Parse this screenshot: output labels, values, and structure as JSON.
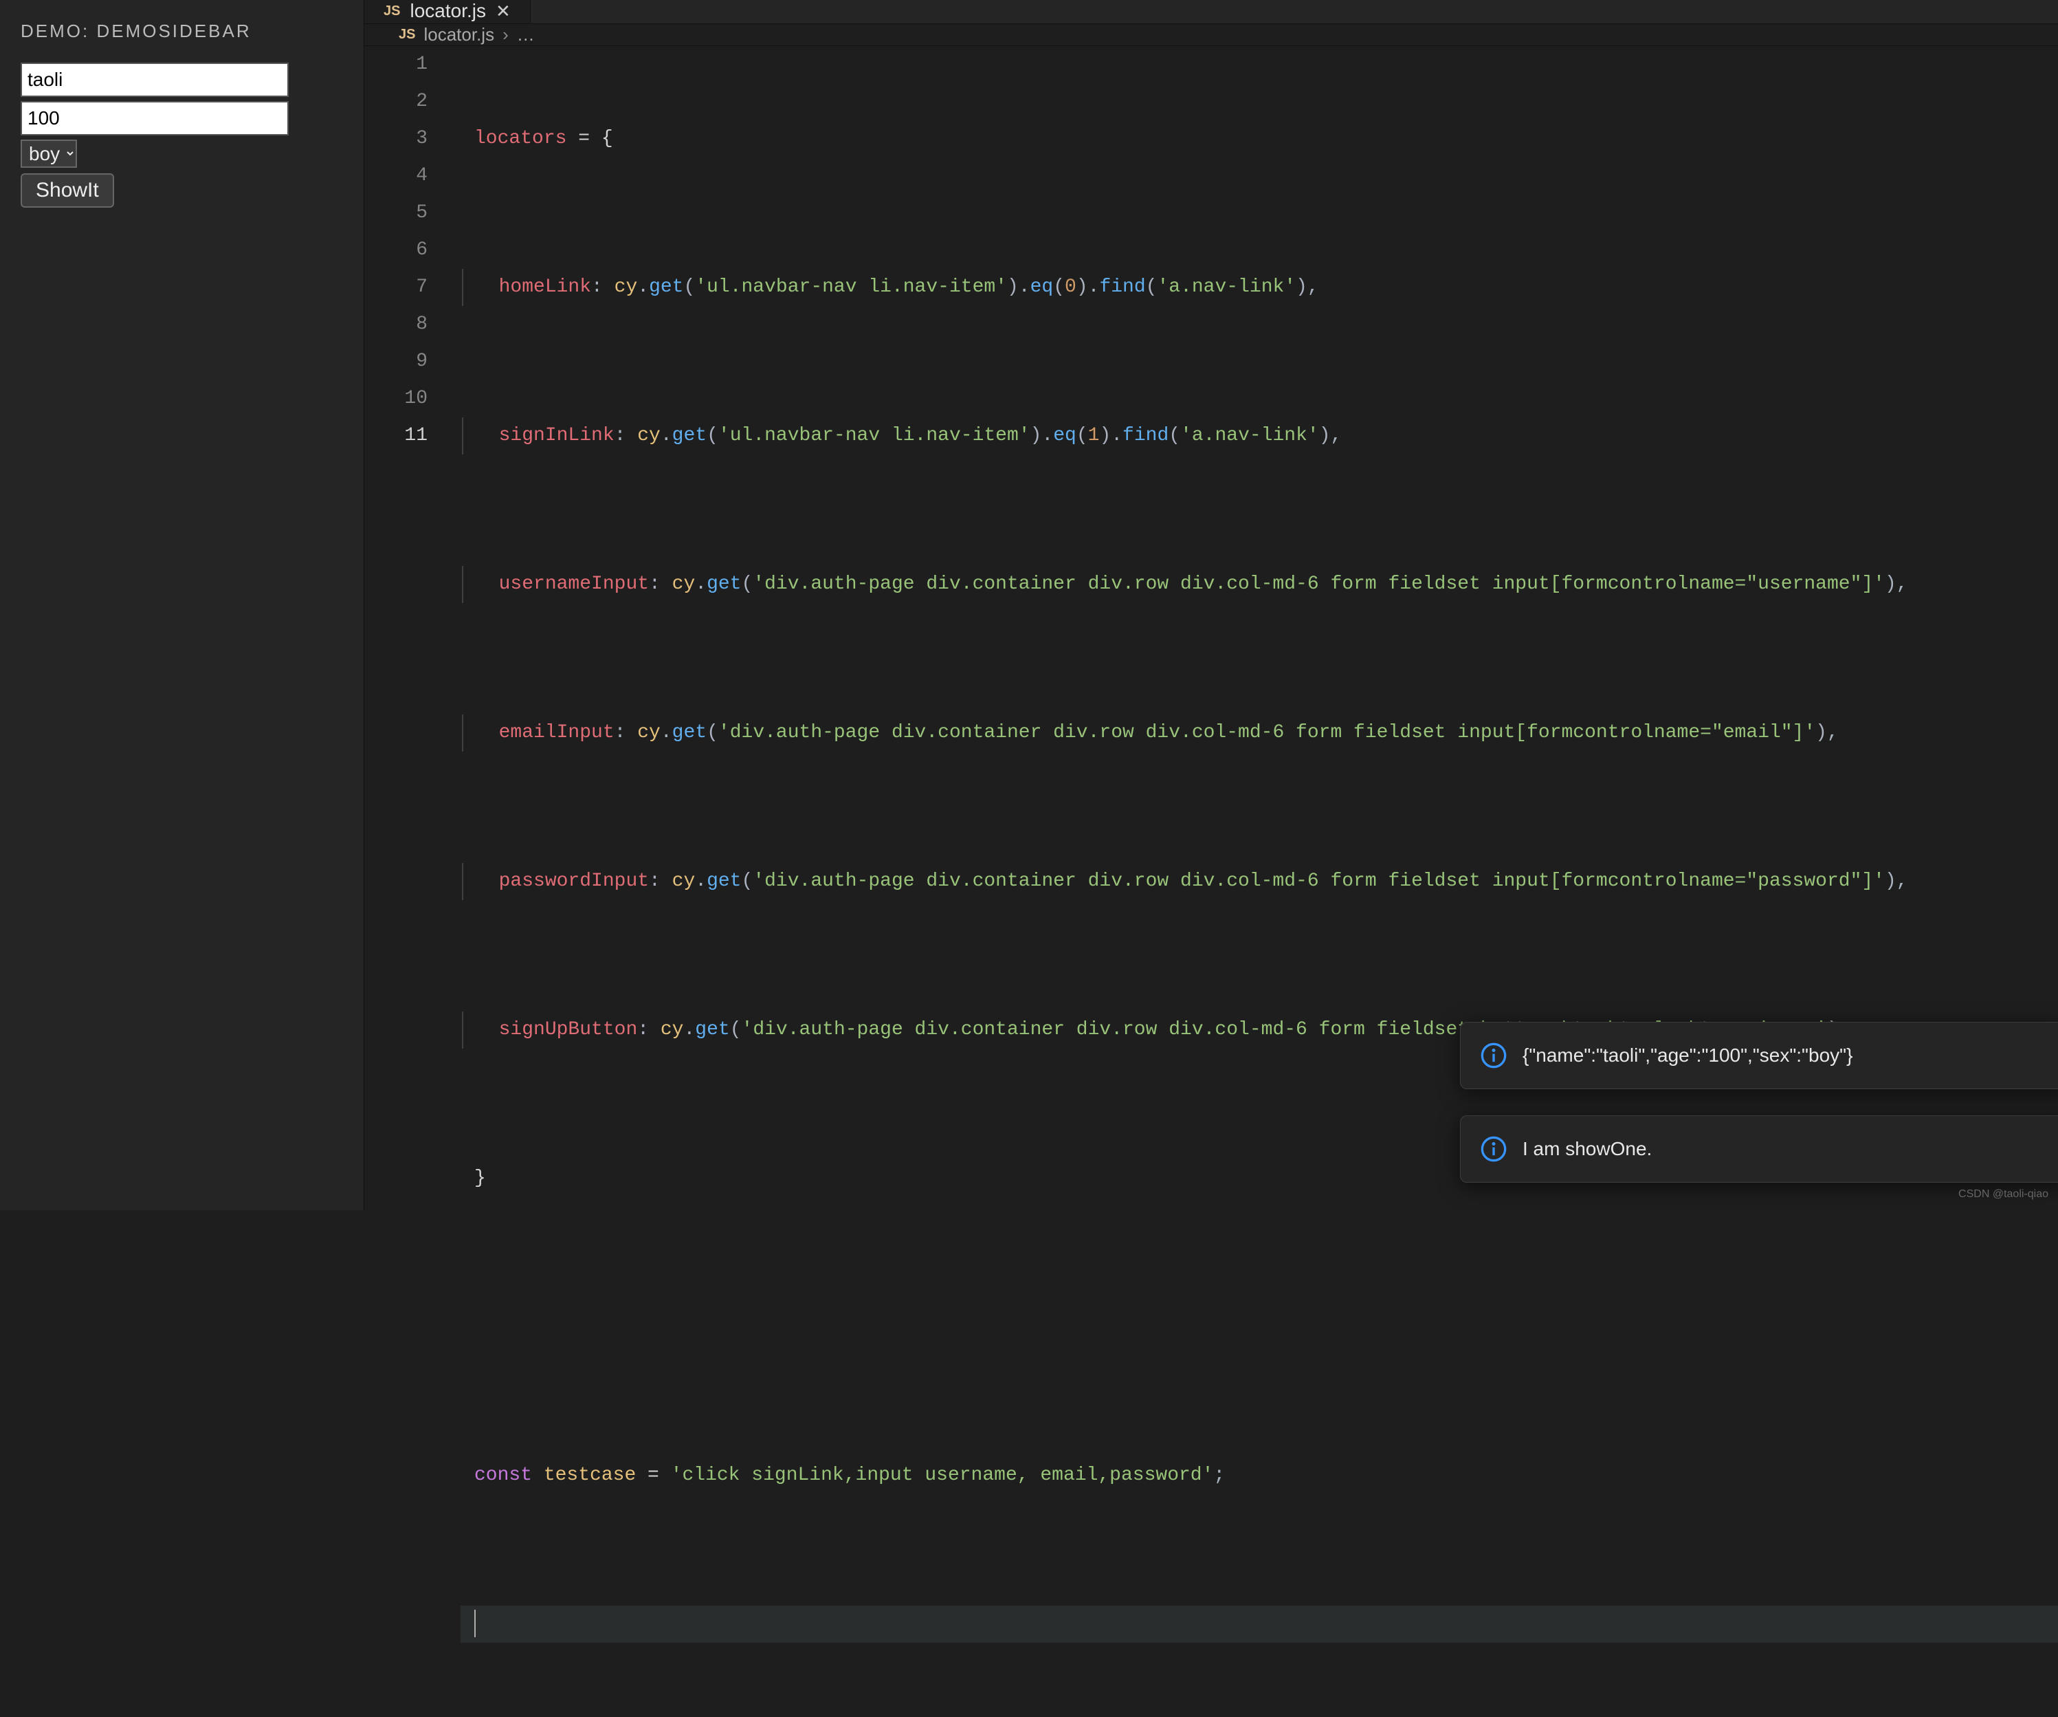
{
  "sidebar": {
    "title": "DEMO: DEMOSIDEBAR",
    "name_value": "taoli",
    "age_value": "100",
    "sex_value": "boy",
    "button_label": "ShowIt"
  },
  "tab": {
    "icon_label": "JS",
    "filename": "locator.js"
  },
  "breadcrumb": {
    "icon_label": "JS",
    "filename": "locator.js",
    "chevron": "›",
    "ellipsis": "…"
  },
  "line_numbers": [
    "1",
    "2",
    "3",
    "4",
    "5",
    "6",
    "7",
    "8",
    "9",
    "10",
    "11"
  ],
  "code": {
    "l1": {
      "a": "locators",
      "b": " = {"
    },
    "l2": {
      "prop": "homeLink",
      "colon": ": ",
      "obj": "cy",
      "dot": ".",
      "fn1": "get",
      "p1": "(",
      "s1": "'ul.navbar-nav li.nav-item'",
      "p2": ").",
      "fn2": "eq",
      "p3": "(",
      "n": "0",
      "p4": ").",
      "fn3": "find",
      "p5": "(",
      "s2": "'a.nav-link'",
      "p6": "),"
    },
    "l3": {
      "prop": "signInLink",
      "colon": ": ",
      "obj": "cy",
      "dot": ".",
      "fn1": "get",
      "p1": "(",
      "s1": "'ul.navbar-nav li.nav-item'",
      "p2": ").",
      "fn2": "eq",
      "p3": "(",
      "n": "1",
      "p4": ").",
      "fn3": "find",
      "p5": "(",
      "s2": "'a.nav-link'",
      "p6": "),"
    },
    "l4": {
      "prop": "usernameInput",
      "colon": ": ",
      "obj": "cy",
      "dot": ".",
      "fn1": "get",
      "p1": "(",
      "s1": "'div.auth-page div.container div.row div.col-md-6 form fieldset input[formcontrolname=\"username\"]'",
      "p2": "),"
    },
    "l5": {
      "prop": "emailInput",
      "colon": ": ",
      "obj": "cy",
      "dot": ".",
      "fn1": "get",
      "p1": "(",
      "s1": "'div.auth-page div.container div.row div.col-md-6 form fieldset input[formcontrolname=\"email\"]'",
      "p2": "),"
    },
    "l6": {
      "prop": "passwordInput",
      "colon": ": ",
      "obj": "cy",
      "dot": ".",
      "fn1": "get",
      "p1": "(",
      "s1": "'div.auth-page div.container div.row div.col-md-6 form fieldset input[formcontrolname=\"password\"]'",
      "p2": "),"
    },
    "l7": {
      "prop": "signUpButton",
      "colon": ": ",
      "obj": "cy",
      "dot": ".",
      "fn1": "get",
      "p1": "(",
      "s1": "'div.auth-page div.container div.row div.col-md-6 form fieldset button.btn.btn-lg.btn-primary'",
      "p2": "),"
    },
    "l8": {
      "a": "}"
    },
    "l10": {
      "kw": "const",
      "sp": " ",
      "name": "testcase",
      "eq": " = ",
      "str": "'click signLink,input username, email,password'",
      "semi": ";"
    }
  },
  "toasts": [
    "{\"name\":\"taoli\",\"age\":\"100\",\"sex\":\"boy\"}",
    "I am showOne."
  ],
  "watermark": "CSDN @taoli-qiao"
}
